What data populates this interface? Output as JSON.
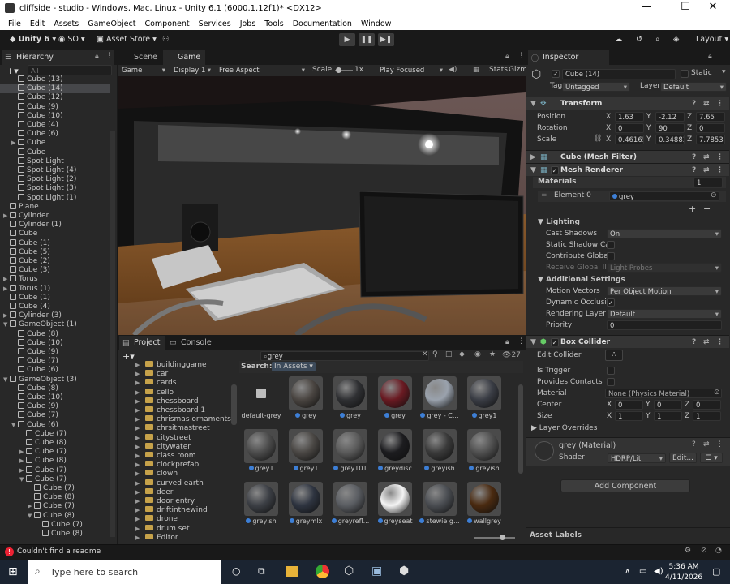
{
  "window": {
    "title": "cliffside - studio - Windows, Mac, Linux - Unity 6.1 (6000.1.12f1)* <DX12>",
    "minimize": "—",
    "maximize": "☐",
    "close": "✕"
  },
  "menu": [
    "File",
    "Edit",
    "Assets",
    "GameObject",
    "Component",
    "Services",
    "Jobs",
    "Tools",
    "Documentation",
    "Window"
  ],
  "toolbar": {
    "version": "Unity 6",
    "account": "SO",
    "asset_store": "Asset Store",
    "layout": "Layout"
  },
  "hierarchy": {
    "tab": "Hierarchy",
    "search_placeholder": "All",
    "rows": [
      {
        "indent": 2,
        "label": "Cube (13)",
        "state": ""
      },
      {
        "indent": 2,
        "label": "Cube (14)",
        "state": "hl"
      },
      {
        "indent": 2,
        "label": "Cube (12)",
        "state": ""
      },
      {
        "indent": 2,
        "label": "Cube (9)",
        "state": ""
      },
      {
        "indent": 2,
        "label": "Cube (10)",
        "state": ""
      },
      {
        "indent": 2,
        "label": "Cube (4)",
        "state": ""
      },
      {
        "indent": 2,
        "label": "Cube (6)",
        "state": ""
      },
      {
        "indent": 2,
        "label": "Cube",
        "state": "",
        "arrow": "▶"
      },
      {
        "indent": 2,
        "label": "Cube",
        "state": ""
      },
      {
        "indent": 2,
        "label": "Spot Light",
        "state": ""
      },
      {
        "indent": 2,
        "label": "Spot Light (4)",
        "state": ""
      },
      {
        "indent": 2,
        "label": "Spot Light (2)",
        "state": ""
      },
      {
        "indent": 2,
        "label": "Spot Light (3)",
        "state": ""
      },
      {
        "indent": 2,
        "label": "Spot Light (1)",
        "state": ""
      },
      {
        "indent": 1,
        "label": "Plane",
        "state": ""
      },
      {
        "indent": 1,
        "label": "Cylinder",
        "state": "",
        "arrow": "▶"
      },
      {
        "indent": 1,
        "label": "Cylinder (1)",
        "state": ""
      },
      {
        "indent": 1,
        "label": "Cube",
        "state": ""
      },
      {
        "indent": 1,
        "label": "Cube (1)",
        "state": ""
      },
      {
        "indent": 1,
        "label": "Cube (5)",
        "state": ""
      },
      {
        "indent": 1,
        "label": "Cube (2)",
        "state": ""
      },
      {
        "indent": 1,
        "label": "Cube (3)",
        "state": ""
      },
      {
        "indent": 1,
        "label": "Torus",
        "state": "",
        "arrow": "▶"
      },
      {
        "indent": 1,
        "label": "Torus (1)",
        "state": "",
        "arrow": "▶"
      },
      {
        "indent": 1,
        "label": "Cube (1)",
        "state": ""
      },
      {
        "indent": 1,
        "label": "Cube (4)",
        "state": ""
      },
      {
        "indent": 1,
        "label": "Cylinder (3)",
        "state": "",
        "arrow": "▶"
      },
      {
        "indent": 1,
        "label": "GameObject (1)",
        "state": "",
        "arrow": "▼"
      },
      {
        "indent": 2,
        "label": "Cube (8)",
        "state": ""
      },
      {
        "indent": 2,
        "label": "Cube (10)",
        "state": ""
      },
      {
        "indent": 2,
        "label": "Cube (9)",
        "state": ""
      },
      {
        "indent": 2,
        "label": "Cube (7)",
        "state": ""
      },
      {
        "indent": 2,
        "label": "Cube (6)",
        "state": ""
      },
      {
        "indent": 1,
        "label": "GameObject (3)",
        "state": "",
        "arrow": "▼"
      },
      {
        "indent": 2,
        "label": "Cube (8)",
        "state": ""
      },
      {
        "indent": 2,
        "label": "Cube (10)",
        "state": ""
      },
      {
        "indent": 2,
        "label": "Cube (9)",
        "state": ""
      },
      {
        "indent": 2,
        "label": "Cube (7)",
        "state": ""
      },
      {
        "indent": 2,
        "label": "Cube (6)",
        "state": "",
        "arrow": "▼"
      },
      {
        "indent": 3,
        "label": "Cube (7)",
        "state": ""
      },
      {
        "indent": 3,
        "label": "Cube (8)",
        "state": ""
      },
      {
        "indent": 3,
        "label": "Cube (7)",
        "state": "",
        "arrow": "▶"
      },
      {
        "indent": 3,
        "label": "Cube (8)",
        "state": "",
        "arrow": "▶"
      },
      {
        "indent": 3,
        "label": "Cube (7)",
        "state": "",
        "arrow": "▶"
      },
      {
        "indent": 3,
        "label": "Cube (7)",
        "state": "",
        "arrow": "▼"
      },
      {
        "indent": 4,
        "label": "Cube (7)",
        "state": ""
      },
      {
        "indent": 4,
        "label": "Cube (8)",
        "state": ""
      },
      {
        "indent": 4,
        "label": "Cube (7)",
        "state": "",
        "arrow": "▶"
      },
      {
        "indent": 4,
        "label": "Cube (8)",
        "state": "",
        "arrow": "▼"
      },
      {
        "indent": 5,
        "label": "Cube (7)",
        "state": ""
      },
      {
        "indent": 5,
        "label": "Cube (8)",
        "state": ""
      }
    ]
  },
  "game": {
    "tabs": [
      "Scene",
      "Game"
    ],
    "display_mode": "Game",
    "display": "Display 1",
    "aspect": "Free Aspect",
    "scale_label": "Scale",
    "scale_value": "1x",
    "play_mode": "Play Focused",
    "stats": "Stats",
    "gizmos": "Gizm"
  },
  "inspector": {
    "tab": "Inspector",
    "name": "Cube (14)",
    "static": "Static",
    "tag_label": "Tag",
    "tag": "Untagged",
    "layer_label": "Layer",
    "layer": "Default",
    "transform": {
      "title": "Transform",
      "position_label": "Position",
      "rotation_label": "Rotation",
      "scale_label": "Scale",
      "position": [
        "1.63",
        "-2.12",
        "7.65"
      ],
      "rotation": [
        "0",
        "90",
        "0"
      ],
      "scale": [
        "0.46165",
        "0.34883",
        "7.78530"
      ]
    },
    "mesh_filter": "Cube (Mesh Filter)",
    "mesh_renderer": "Mesh Renderer",
    "materials_label": "Materials",
    "materials_count": "1",
    "element0_label": "Element 0",
    "element0": "grey",
    "lighting": {
      "title": "Lighting",
      "cast_shadows_label": "Cast Shadows",
      "cast_shadows": "On",
      "static_caster": "Static Shadow Cas",
      "contribute_gi": "Contribute Global",
      "receive_gi_label": "Receive Global Illu",
      "receive_gi": "Light Probes"
    },
    "additional": {
      "title": "Additional Settings",
      "motion_vectors_label": "Motion Vectors",
      "motion_vectors": "Per Object Motion",
      "dynamic_occlusion": "Dynamic Occlusio",
      "rendering_layer_label": "Rendering Layer M",
      "rendering_layer": "Default",
      "priority_label": "Priority",
      "priority": "0"
    },
    "box_collider": {
      "title": "Box Collider",
      "edit_collider": "Edit Collider",
      "is_trigger": "Is Trigger",
      "provides_contacts": "Provides Contacts",
      "material_label": "Material",
      "material": "None (Physics Material)",
      "center_label": "Center",
      "center": [
        "0",
        "0",
        "0"
      ],
      "size_label": "Size",
      "size": [
        "1",
        "1",
        "1"
      ],
      "layer_overrides": "Layer Overrides"
    },
    "material_card": {
      "name": "grey (Material)",
      "shader_label": "Shader",
      "shader": "HDRP/Lit",
      "edit": "Edit..."
    },
    "add_component": "Add Component",
    "asset_labels": "Asset Labels"
  },
  "project": {
    "tabs": [
      "Project",
      "Console"
    ],
    "search_value": "grey",
    "search_label": "Search:",
    "search_scope": "In Assets",
    "count": "27",
    "folders": [
      "buildinggame",
      "car",
      "cards",
      "cello",
      "chessboard",
      "chessboard 1",
      "chrismas ornaments",
      "chrsitmastreet",
      "citystreet",
      "citywater",
      "class room",
      "clockprefab",
      "clown",
      "curved earth",
      "deer",
      "door entry",
      "driftinthewind",
      "drone",
      "drum set",
      "Editor"
    ],
    "assets": [
      {
        "label": "default-grey",
        "color": "",
        "kind": "small"
      },
      {
        "label": "grey",
        "color": "#4a4541",
        "kind": "ball"
      },
      {
        "label": "grey",
        "color": "#2f3033",
        "kind": "ball"
      },
      {
        "label": "grey",
        "color": "#6a1a22",
        "kind": "ball"
      },
      {
        "label": "grey - C...",
        "color": "#9aa2ad",
        "kind": "ball"
      },
      {
        "label": "grey1",
        "color": "#3a3d45",
        "kind": "ball"
      },
      {
        "label": "grey1",
        "color": "#4c4c4c",
        "kind": "ball"
      },
      {
        "label": "grey1",
        "color": "#4a4744",
        "kind": "ball"
      },
      {
        "label": "grey101",
        "color": "#5a5a5a",
        "kind": "ball"
      },
      {
        "label": "greydisc",
        "color": "#1c1c1f",
        "kind": "ball"
      },
      {
        "label": "greyish",
        "color": "#3a3a3a",
        "kind": "ball"
      },
      {
        "label": "greyish",
        "color": "#505050",
        "kind": "ball"
      },
      {
        "label": "greyish",
        "color": "#3c3f45",
        "kind": "ball"
      },
      {
        "label": "greymlx",
        "color": "#2e3440",
        "kind": "ball"
      },
      {
        "label": "greyrefl...",
        "color": "#5a5d62",
        "kind": "ball"
      },
      {
        "label": "greyseat",
        "color": "#f4f4f4",
        "kind": "ball"
      },
      {
        "label": "stewie g...",
        "color": "#4a4d52",
        "kind": "ball"
      },
      {
        "label": "wallgrey",
        "color": "#4a2a10",
        "kind": "ball"
      }
    ]
  },
  "status": {
    "message": "Couldn't find a readme"
  },
  "taskbar": {
    "search_placeholder": "Type here to search",
    "time": "5:36 AM",
    "date": "4/11/2026"
  }
}
